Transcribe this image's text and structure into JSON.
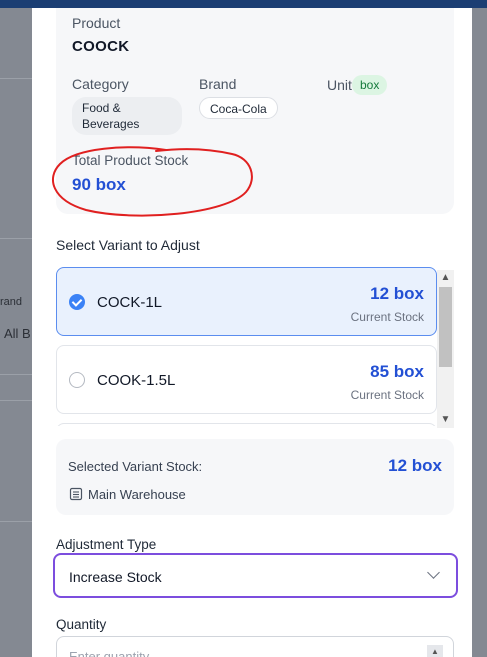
{
  "background": {
    "left_text_1": "rand",
    "left_text_2": "All B"
  },
  "product": {
    "product_label": "Product",
    "product_name": "COOCK",
    "category_label": "Category",
    "category_value": "Food & Beverages",
    "brand_label": "Brand",
    "brand_value": "Coca-Cola",
    "unit_label": "Unit",
    "unit_value": "box",
    "total_stock_label": "Total Product Stock",
    "total_stock_value": "90 box"
  },
  "variants": {
    "label": "Select Variant to Adjust",
    "items": [
      {
        "name": "COCK-1L",
        "qty": "12 box",
        "sub": "Current Stock",
        "selected": true
      },
      {
        "name": "COOK-1.5L",
        "qty": "85 box",
        "sub": "Current Stock",
        "selected": false
      }
    ]
  },
  "selected_stock": {
    "label": "Selected Variant Stock:",
    "value": "12 box",
    "warehouse": "Main Warehouse"
  },
  "adjustment": {
    "label": "Adjustment Type",
    "value": "Increase Stock"
  },
  "quantity": {
    "label": "Quantity",
    "placeholder": "Enter quantity"
  },
  "colors": {
    "accent_blue": "#2350d4",
    "focus_purple": "#7c4dde",
    "annotation_red": "#e02020"
  }
}
